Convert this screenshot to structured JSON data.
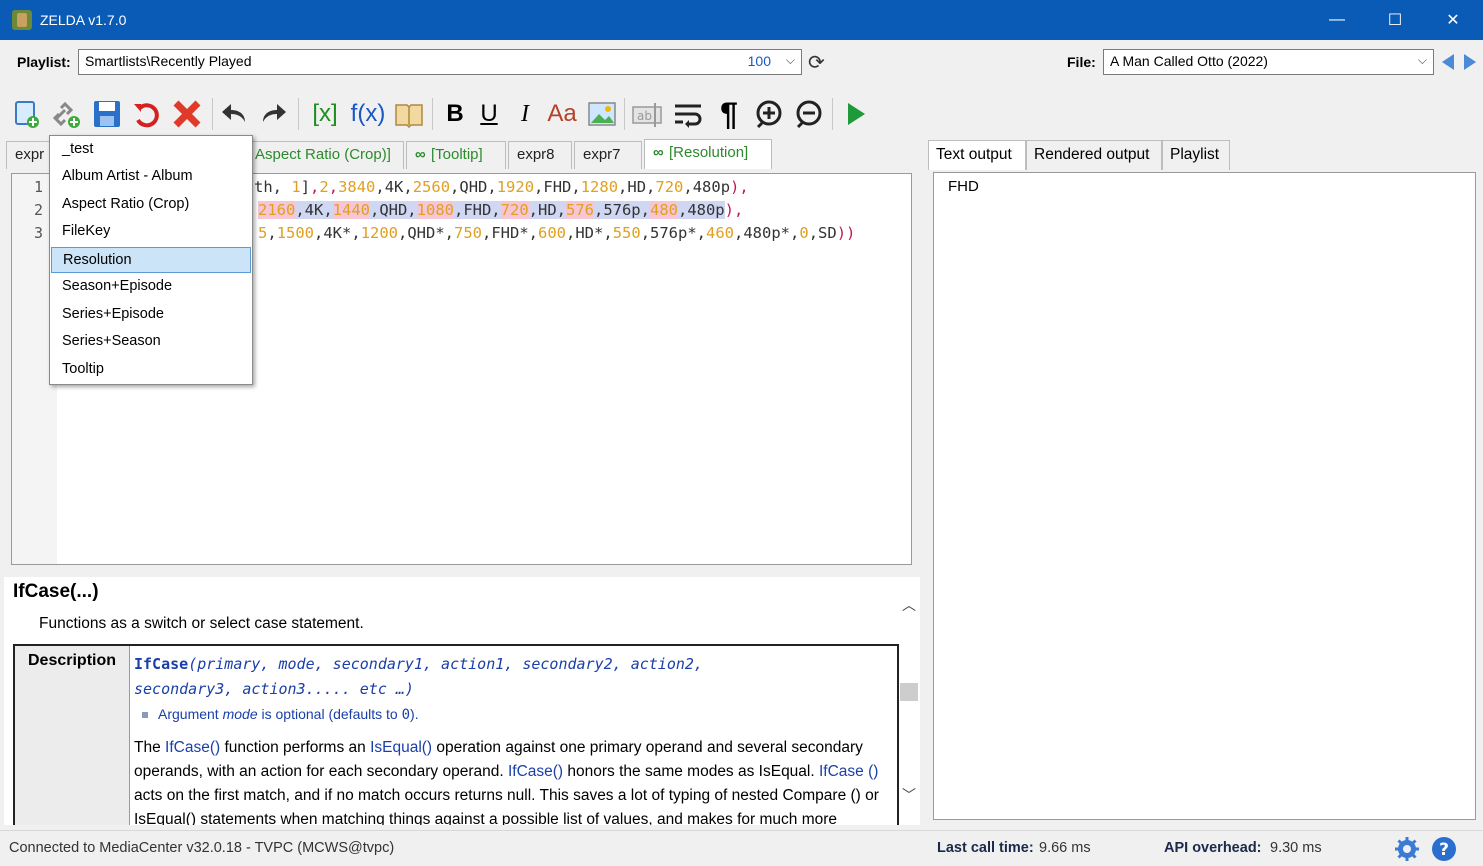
{
  "window": {
    "title": "ZELDA v1.7.0",
    "controls": {
      "minimize": "—",
      "maximize": "☐",
      "close": "✕"
    }
  },
  "playlist": {
    "label": "Playlist:",
    "value": "Smartlists\\Recently Played",
    "count": "100"
  },
  "file": {
    "label": "File:",
    "value": "A Man Called Otto (2022)"
  },
  "toolbar": {
    "expr_label": "[x]",
    "func_label": "f(x)",
    "bold": "B",
    "underline": "U",
    "italic": "I",
    "case": "Aa",
    "pilcrow": "¶"
  },
  "tabs": [
    {
      "label": "expr"
    },
    {
      "label": "Aspect Ratio (Crop)]"
    },
    {
      "label": "[Tooltip]"
    },
    {
      "label": "expr8"
    },
    {
      "label": "expr7"
    },
    {
      "label": "[Resolution]"
    }
  ],
  "editor": {
    "line_numbers": [
      "1",
      "2",
      "3"
    ]
  },
  "menu": {
    "items": [
      "_test",
      "Album Artist - Album",
      "Aspect Ratio (Crop)",
      "FileKey",
      "Resolution",
      "Season+Episode",
      "Series+Episode",
      "Series+Season",
      "Tooltip"
    ],
    "selected_index": 4
  },
  "help": {
    "title": "IfCase(...)",
    "subtitle": "Functions as a switch or select case statement.",
    "description_label": "Description",
    "sig_name": "IfCase",
    "sig_args_1": "(primary, mode, secondary1, action1, secondary2, action2,",
    "sig_args_2": "secondary3, action3..... etc …)",
    "bullet_pre": "Argument ",
    "bullet_em": "mode",
    "bullet_post": " is optional (defaults to ",
    "bullet_val": "0",
    "bullet_end": ").",
    "para": {
      "t1": "The ",
      "l1": "IfCase()",
      "t2": " function performs an ",
      "l2": "IsEqual()",
      "t3": " operation against one primary operand and several secondary operands, with an action for each secondary operand. ",
      "l3": "IfCase()",
      "t4": " honors the same modes as IsEqual. ",
      "l4": "IfCase ()",
      "t5": " acts on the first match, and if no match occurs returns null. This saves a lot of typing of nested Compare () or IsEqual() statements when matching things against a possible list of values, and makes for much more"
    }
  },
  "right_tabs": [
    "Text output",
    "Rendered output",
    "Playlist"
  ],
  "output": {
    "text": "FHD"
  },
  "status": {
    "connection": "Connected to MediaCenter v32.0.18 - TVPC (MCWS@tvpc)",
    "last_call_label": "Last call time:",
    "last_call_value": "9.66 ms",
    "api_label": "API overhead:",
    "api_value": "9.30 ms"
  },
  "colors": {
    "titlebar": "#0a5bb5",
    "accent_blue": "#1a56c6",
    "link_green": "#2c8a2c",
    "selection": "#cce4f7"
  }
}
